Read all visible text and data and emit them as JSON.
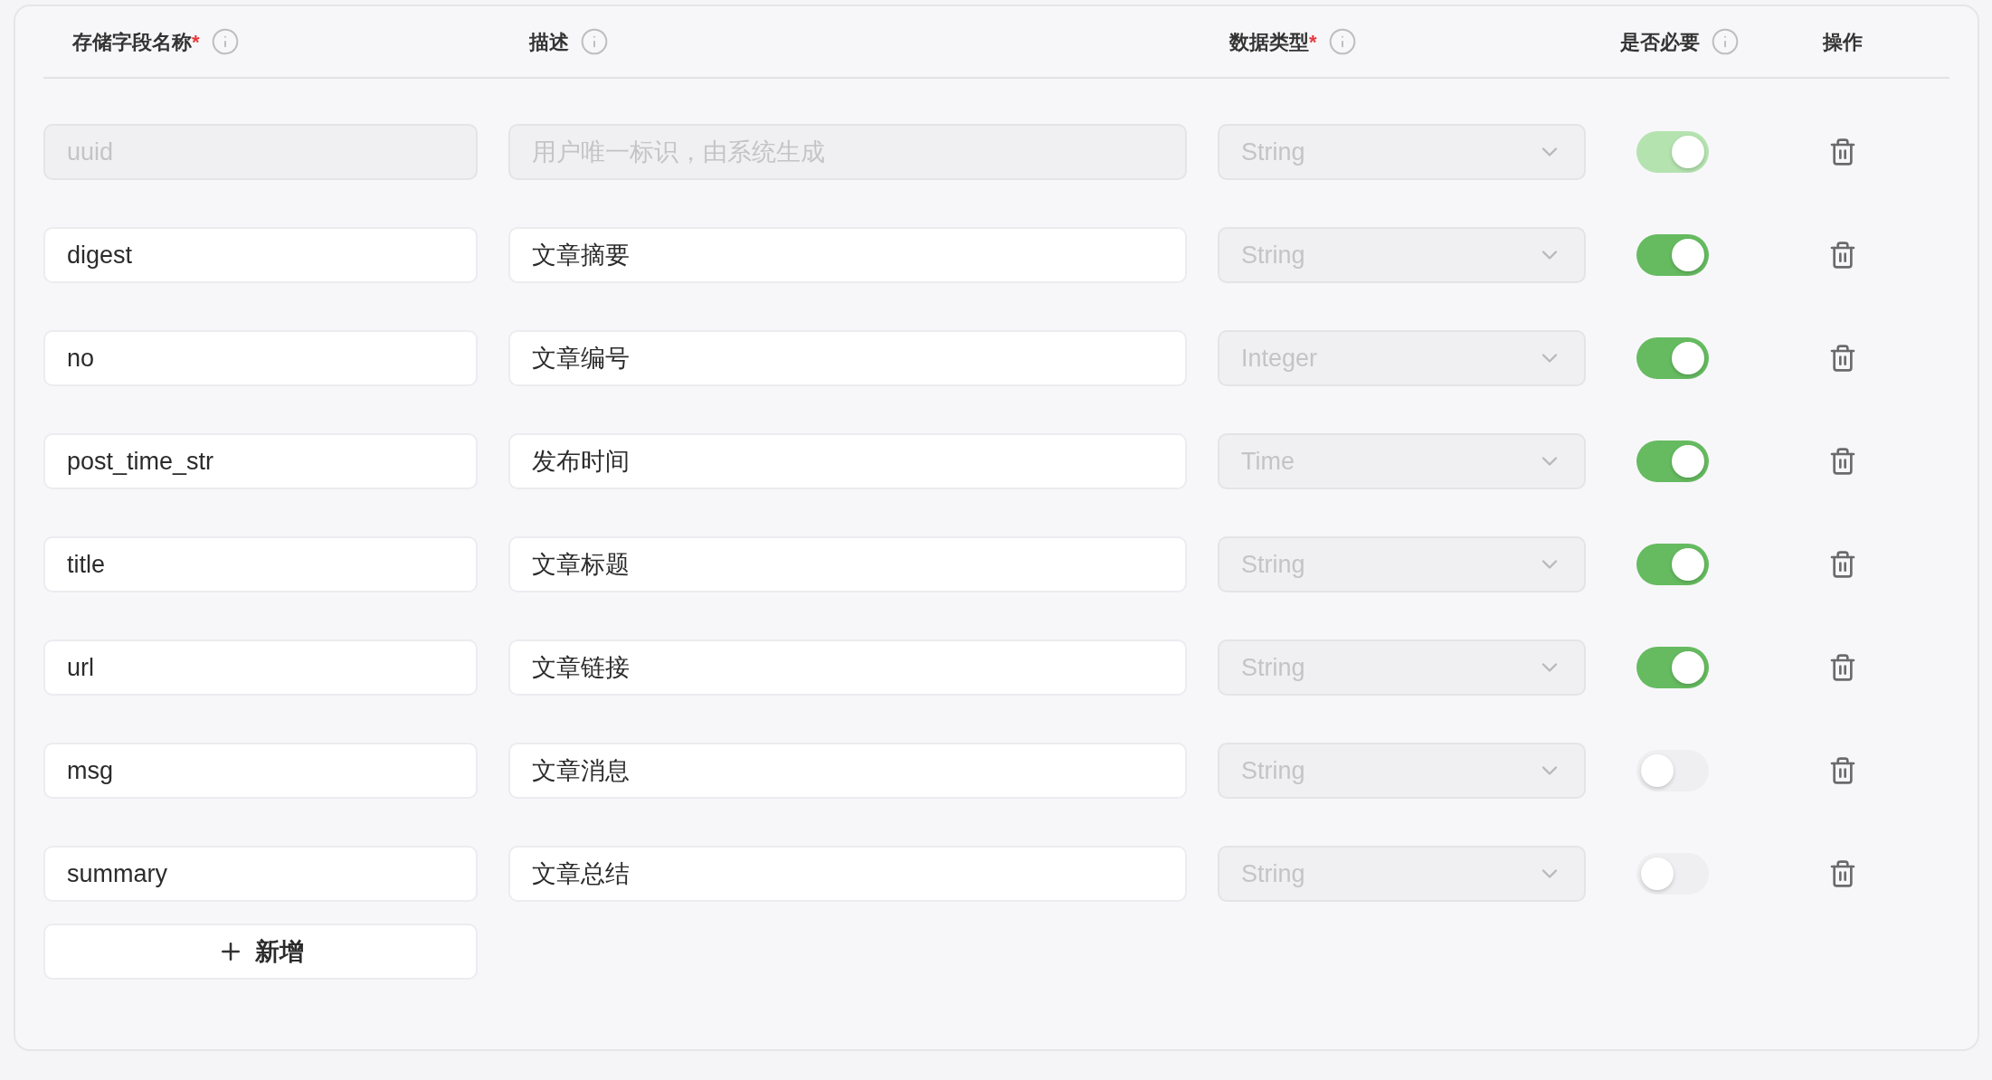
{
  "columns": [
    {
      "label": "存储字段名称",
      "required_mark": "*",
      "info": true
    },
    {
      "label": "描述",
      "info": true
    },
    {
      "label": "数据类型",
      "required_mark": "*",
      "info": true
    },
    {
      "label": "是否必要",
      "info": true
    },
    {
      "label": "操作",
      "info": false
    }
  ],
  "rows": [
    {
      "name": "uuid",
      "description": "用户唯一标识，由系统生成",
      "type": "String",
      "required": true,
      "disabled": true
    },
    {
      "name": "digest",
      "description": "文章摘要",
      "type": "String",
      "required": true,
      "disabled": false
    },
    {
      "name": "no",
      "description": "文章编号",
      "type": "Integer",
      "required": true,
      "disabled": false
    },
    {
      "name": "post_time_str",
      "description": "发布时间",
      "type": "Time",
      "required": true,
      "disabled": false
    },
    {
      "name": "title",
      "description": "文章标题",
      "type": "String",
      "required": true,
      "disabled": false
    },
    {
      "name": "url",
      "description": "文章链接",
      "type": "String",
      "required": true,
      "disabled": false
    },
    {
      "name": "msg",
      "description": "文章消息",
      "type": "String",
      "required": false,
      "disabled": false
    },
    {
      "name": "summary",
      "description": "文章总结",
      "type": "String",
      "required": false,
      "disabled": false
    }
  ],
  "add_button": {
    "label": "新增"
  }
}
